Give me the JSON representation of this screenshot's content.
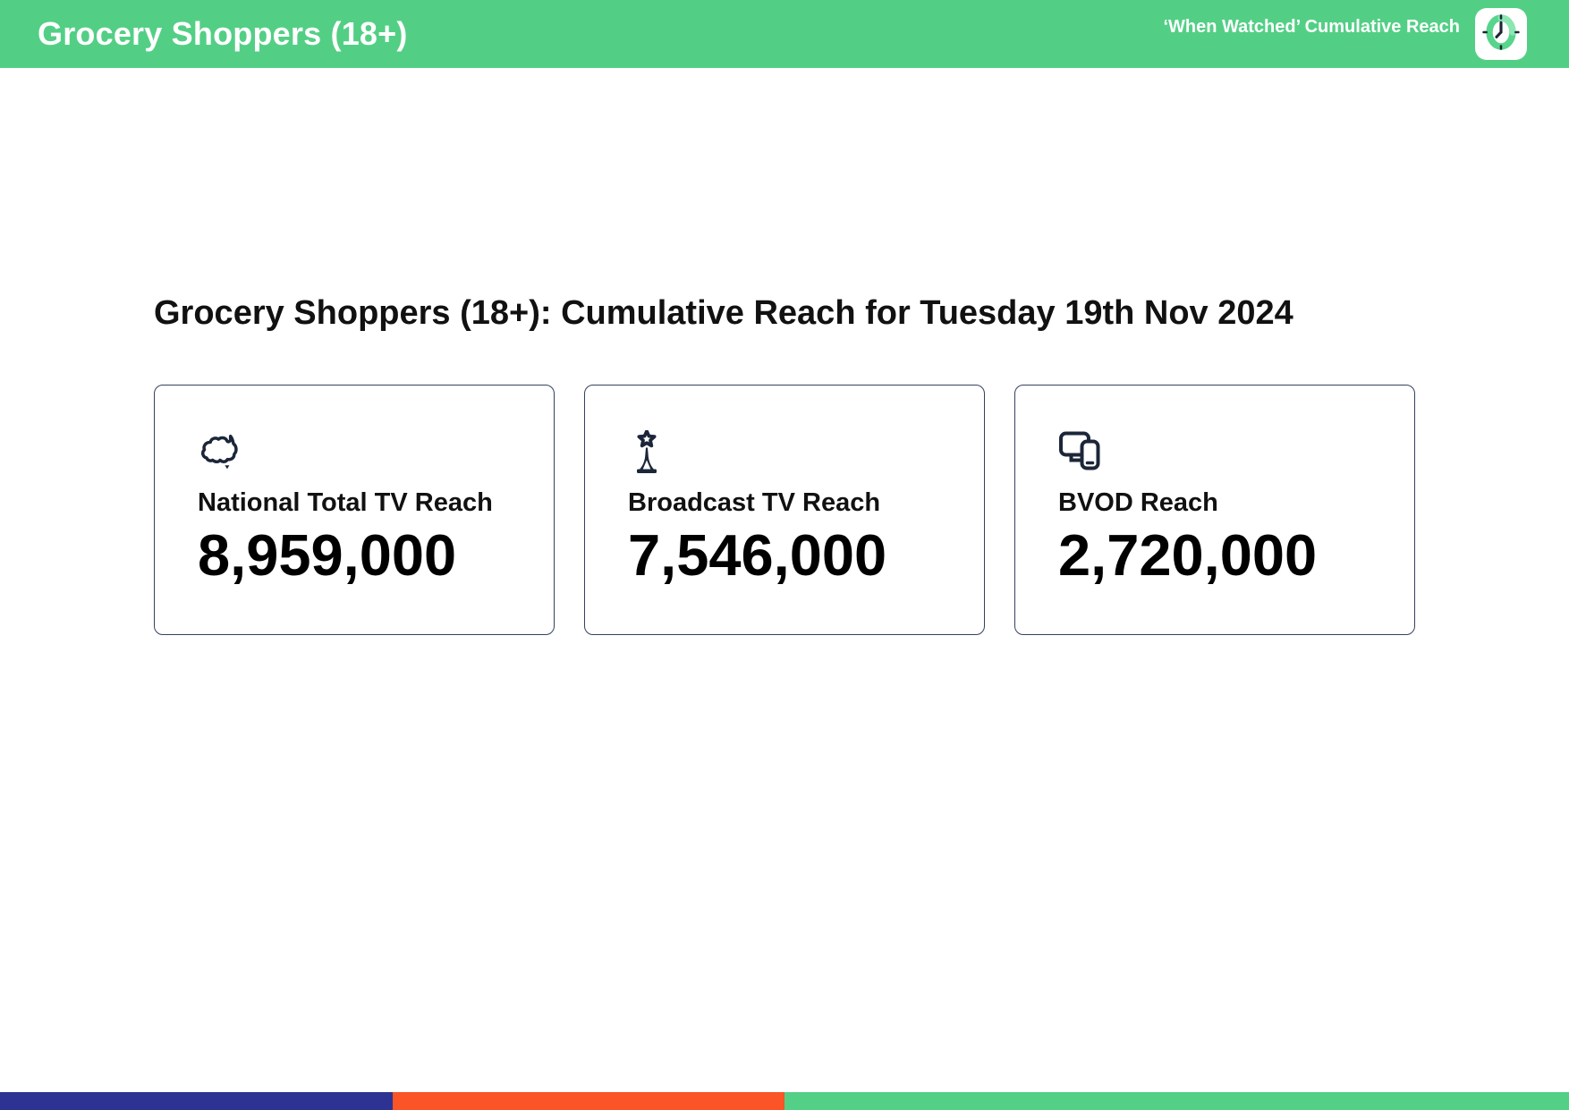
{
  "header": {
    "title": "Grocery Shoppers (18+)",
    "right_label": "‘When Watched’ Cumulative Reach",
    "logo_icon": "clock-icon"
  },
  "main": {
    "heading": "Grocery Shoppers (18+): Cumulative Reach for Tuesday 19th Nov 2024",
    "cards": [
      {
        "icon": "australia-map-icon",
        "label": "National Total TV Reach",
        "value": "8,959,000"
      },
      {
        "icon": "broadcast-tower-icon",
        "label": "Broadcast TV Reach",
        "value": "7,546,000"
      },
      {
        "icon": "devices-icon",
        "label": "BVOD Reach",
        "value": "2,720,000"
      }
    ]
  },
  "footer": {
    "segments": [
      {
        "name": "blue-segment",
        "color": "#2d3392",
        "width_pct": 25
      },
      {
        "name": "orange-segment",
        "color": "#fb5426",
        "width_pct": 25
      },
      {
        "name": "green-segment",
        "color": "#53d086",
        "width_pct": 50
      }
    ]
  },
  "colors": {
    "header_green": "#53cf85",
    "card_border": "#34425f",
    "icon_navy": "#1c2639",
    "text_black": "#111111"
  }
}
